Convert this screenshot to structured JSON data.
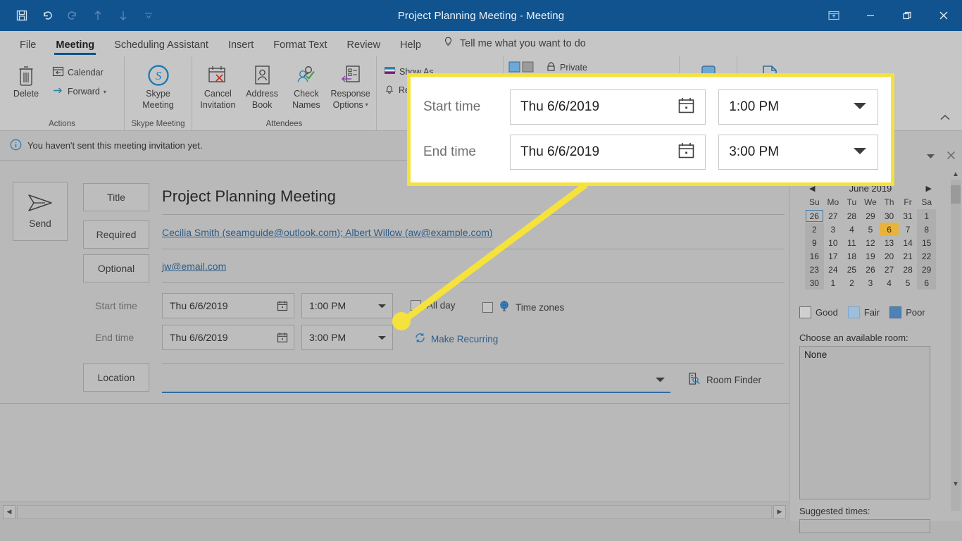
{
  "titlebar": {
    "title": "Project Planning Meeting",
    "separator": "-",
    "subtitle": "Meeting",
    "qat": [
      {
        "name": "save-icon",
        "label": "Save"
      },
      {
        "name": "undo-icon",
        "label": "Undo"
      },
      {
        "name": "redo-icon",
        "label": "Redo"
      },
      {
        "name": "previous-item-icon",
        "label": "Previous Item"
      },
      {
        "name": "next-item-icon",
        "label": "Next Item"
      },
      {
        "name": "customize-quick-access-toolbar-icon",
        "label": "Customize Quick Access Toolbar"
      }
    ],
    "window_controls": [
      {
        "name": "ribbon-display-options-icon",
        "label": "Ribbon Display Options"
      },
      {
        "name": "minimize-icon",
        "label": "Minimize"
      },
      {
        "name": "restore-icon",
        "label": "Restore Down"
      },
      {
        "name": "close-icon",
        "label": "Close"
      }
    ]
  },
  "tabs": [
    {
      "label": "File",
      "active": false
    },
    {
      "label": "Meeting",
      "active": true
    },
    {
      "label": "Scheduling Assistant",
      "active": false
    },
    {
      "label": "Insert",
      "active": false
    },
    {
      "label": "Format Text",
      "active": false
    },
    {
      "label": "Review",
      "active": false
    },
    {
      "label": "Help",
      "active": false
    }
  ],
  "tellme": {
    "icon": "lightbulb-icon",
    "placeholder": "Tell me what you want to do"
  },
  "ribbon": {
    "groups": [
      {
        "label": "Actions",
        "big": [
          {
            "label_line1": "Delete",
            "label_line2": "",
            "icon": "trash-icon"
          }
        ],
        "small": [
          {
            "label": "Calendar",
            "icon": "calendar-move-icon",
            "caret": false
          },
          {
            "label": "Forward",
            "icon": "forward-arrow-icon",
            "caret": true
          }
        ]
      },
      {
        "label": "Skype Meeting",
        "big": [
          {
            "label_line1": "Skype",
            "label_line2": "Meeting",
            "icon": "skype-icon"
          }
        ],
        "small": []
      },
      {
        "label": "Attendees",
        "big": [
          {
            "label_line1": "Cancel",
            "label_line2": "Invitation",
            "icon": "cancel-invitation-icon"
          },
          {
            "label_line1": "Address",
            "label_line2": "Book",
            "icon": "address-book-icon"
          },
          {
            "label_line1": "Check",
            "label_line2": "Names",
            "icon": "check-names-icon"
          },
          {
            "label_line1": "Response",
            "label_line2": "Options",
            "icon": "response-options-icon",
            "caret": true
          }
        ],
        "small": []
      },
      {
        "label": "",
        "big": [],
        "small": [
          {
            "label": "Show As",
            "icon": "show-as-icon",
            "caret": false
          },
          {
            "label": "Reminder",
            "icon": "reminder-bell-icon",
            "caret": false
          }
        ]
      },
      {
        "label": "",
        "big": [],
        "small": [
          {
            "label": "Private",
            "icon": "lock-icon",
            "caret": false
          }
        ]
      }
    ]
  },
  "infobar": {
    "icon": "info-icon",
    "message": "You haven't sent this meeting invitation yet."
  },
  "form": {
    "send_button": {
      "label": "Send",
      "icon": "send-arrow-icon"
    },
    "title_label": "Title",
    "title_value": "Project Planning Meeting",
    "required_label": "Required",
    "required_value": "Cecilia Smith (seamguide@outlook.com); Albert Willow (aw@example.com)",
    "optional_label": "Optional",
    "optional_value": "jw@email.com",
    "start_time_label": "Start time",
    "start_date_value": "Thu 6/6/2019",
    "start_clock_value": "1:00 PM",
    "end_time_label": "End time",
    "end_date_value": "Thu 6/6/2019",
    "end_clock_value": "3:00 PM",
    "all_day_label": "All day",
    "time_zones_label": "Time zones",
    "make_recurring_label": "Make Recurring",
    "location_label": "Location",
    "location_value": "",
    "room_finder_label": "Room Finder"
  },
  "right_panel": {
    "header_controls": [
      {
        "name": "panel-dropdown-icon",
        "label": "Panel options"
      },
      {
        "name": "panel-close-icon",
        "label": "Close"
      }
    ],
    "calendar": {
      "month_label": "June 2019",
      "prev_icon": "chevron-left-icon",
      "next_icon": "chevron-right-icon",
      "day_headers": [
        "Su",
        "Mo",
        "Tu",
        "We",
        "Th",
        "Fr",
        "Sa"
      ],
      "weeks": [
        [
          {
            "d": "26",
            "s": "out sel"
          },
          {
            "d": "27",
            "s": "out"
          },
          {
            "d": "28",
            "s": "out"
          },
          {
            "d": "29",
            "s": "out"
          },
          {
            "d": "30",
            "s": "out"
          },
          {
            "d": "31",
            "s": "out"
          },
          {
            "d": "1",
            "s": "wknd"
          }
        ],
        [
          {
            "d": "2",
            "s": "wknd"
          },
          {
            "d": "3",
            "s": ""
          },
          {
            "d": "4",
            "s": ""
          },
          {
            "d": "5",
            "s": ""
          },
          {
            "d": "6",
            "s": "today"
          },
          {
            "d": "7",
            "s": ""
          },
          {
            "d": "8",
            "s": "wknd"
          }
        ],
        [
          {
            "d": "9",
            "s": "wknd"
          },
          {
            "d": "10",
            "s": ""
          },
          {
            "d": "11",
            "s": ""
          },
          {
            "d": "12",
            "s": ""
          },
          {
            "d": "13",
            "s": ""
          },
          {
            "d": "14",
            "s": ""
          },
          {
            "d": "15",
            "s": "wknd"
          }
        ],
        [
          {
            "d": "16",
            "s": "wknd"
          },
          {
            "d": "17",
            "s": ""
          },
          {
            "d": "18",
            "s": ""
          },
          {
            "d": "19",
            "s": ""
          },
          {
            "d": "20",
            "s": ""
          },
          {
            "d": "21",
            "s": ""
          },
          {
            "d": "22",
            "s": "wknd"
          }
        ],
        [
          {
            "d": "23",
            "s": "wknd"
          },
          {
            "d": "24",
            "s": ""
          },
          {
            "d": "25",
            "s": ""
          },
          {
            "d": "26",
            "s": ""
          },
          {
            "d": "27",
            "s": ""
          },
          {
            "d": "28",
            "s": ""
          },
          {
            "d": "29",
            "s": "wknd"
          }
        ],
        [
          {
            "d": "30",
            "s": "wknd"
          },
          {
            "d": "1",
            "s": "out"
          },
          {
            "d": "2",
            "s": "out"
          },
          {
            "d": "3",
            "s": "out"
          },
          {
            "d": "4",
            "s": "out"
          },
          {
            "d": "5",
            "s": "out"
          },
          {
            "d": "6",
            "s": "out wknd"
          }
        ]
      ]
    },
    "legend": [
      {
        "label": "Good",
        "color": "#cfcfcf"
      },
      {
        "label": "Fair",
        "color": "#9dbedd"
      },
      {
        "label": "Poor",
        "color": "#4f82b4"
      }
    ],
    "choose_room_label": "Choose an available room:",
    "room_list": [
      "None"
    ],
    "suggested_times_label": "Suggested times:"
  },
  "callout": {
    "border_color": "#f5e23c",
    "rows": [
      {
        "label": "Start time",
        "date": "Thu 6/6/2019",
        "time": "1:00 PM",
        "calendar_icon": "calendar-icon",
        "dropdown_icon": "chevron-down-icon"
      },
      {
        "label": "End time",
        "date": "Thu 6/6/2019",
        "time": "3:00 PM",
        "calendar_icon": "calendar-icon",
        "dropdown_icon": "chevron-down-icon"
      }
    ]
  },
  "scrollbars": {
    "left_arrow_icon": "triangle-left-icon",
    "right_arrow_icon": "triangle-right-icon",
    "up_arrow_icon": "chevron-up-icon",
    "down_arrow_icon": "chevron-down-icon"
  },
  "colors": {
    "titlebar": "#10538f",
    "accent_underline": "#0f5390",
    "highlight_yellow": "#f5e23c",
    "today_highlight": "#e8b33b",
    "link": "#2e5d8a"
  }
}
